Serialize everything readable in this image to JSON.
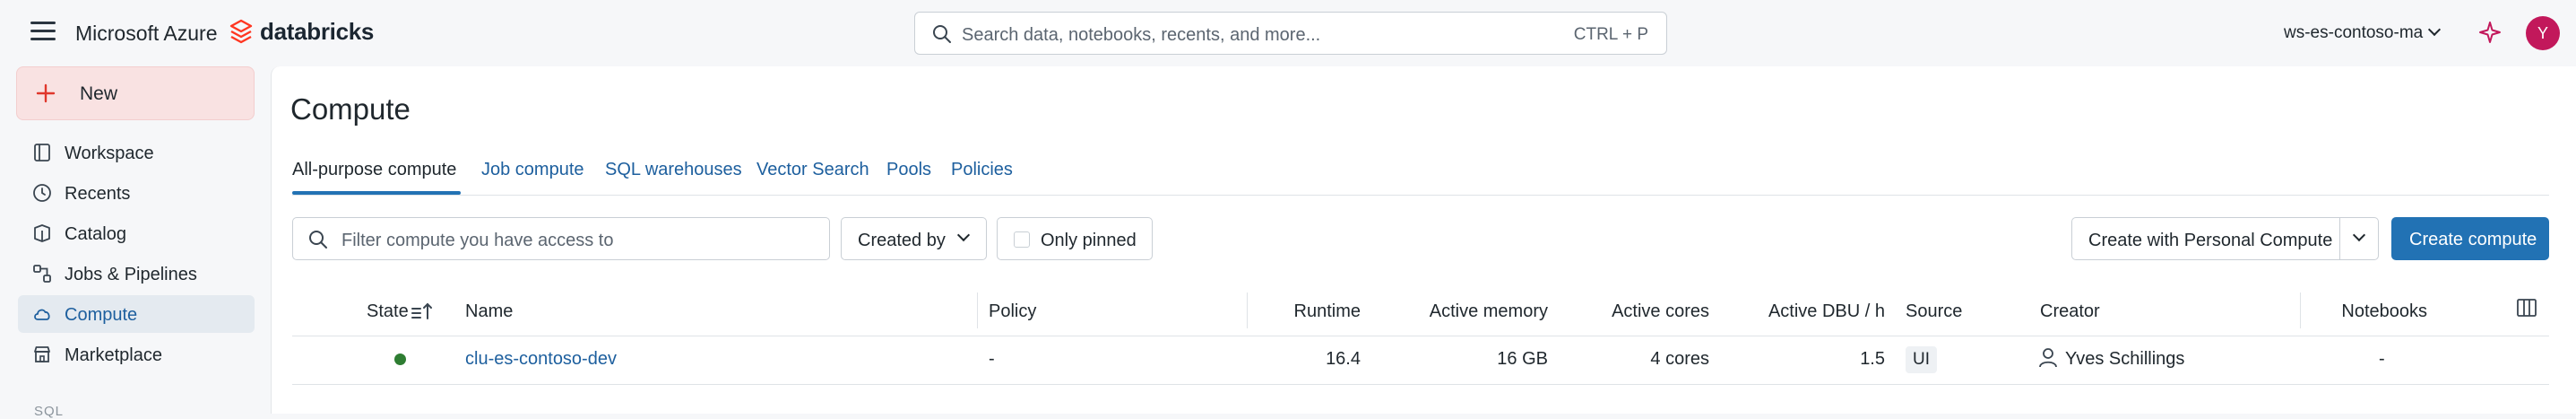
{
  "header": {
    "app_title": "Microsoft Azure",
    "brand": "databricks",
    "search_placeholder": "Search data, notebooks, recents, and more...",
    "search_shortcut": "CTRL + P",
    "workspace": "ws-es-contoso-ma",
    "avatar_initial": "Y",
    "brand_color": "#ff3621",
    "avatar_color": "#c2185b"
  },
  "sidebar": {
    "new_label": "New",
    "items": [
      {
        "label": "Workspace",
        "icon": "folder-icon"
      },
      {
        "label": "Recents",
        "icon": "clock-icon"
      },
      {
        "label": "Catalog",
        "icon": "catalog-icon"
      },
      {
        "label": "Jobs & Pipelines",
        "icon": "workflow-icon"
      },
      {
        "label": "Compute",
        "icon": "cloud-icon",
        "active": true
      },
      {
        "label": "Marketplace",
        "icon": "store-icon"
      }
    ],
    "section_sql": "SQL"
  },
  "page": {
    "title": "Compute",
    "tabs": [
      "All-purpose compute",
      "Job compute",
      "SQL warehouses",
      "Vector Search",
      "Pools",
      "Policies"
    ],
    "active_tab": "All-purpose compute"
  },
  "toolbar": {
    "filter_placeholder": "Filter compute you have access to",
    "created_by": "Created by",
    "only_pinned": "Only pinned",
    "personal_compute": "Create with Personal Compute",
    "create_compute": "Create compute",
    "accent": "#2272b4"
  },
  "table": {
    "headers": [
      "State",
      "Name",
      "Policy",
      "Runtime",
      "Active memory",
      "Active cores",
      "Active DBU / h",
      "Source",
      "Creator",
      "Notebooks"
    ],
    "rows": [
      {
        "state": "running",
        "state_color": "#2e7d32",
        "name": "clu-es-contoso-dev",
        "policy": "-",
        "runtime": "16.4",
        "active_memory": "16 GB",
        "active_cores": "4 cores",
        "active_dbu": "1.5",
        "source": "UI",
        "creator": "Yves Schillings",
        "notebooks": "-"
      }
    ]
  }
}
